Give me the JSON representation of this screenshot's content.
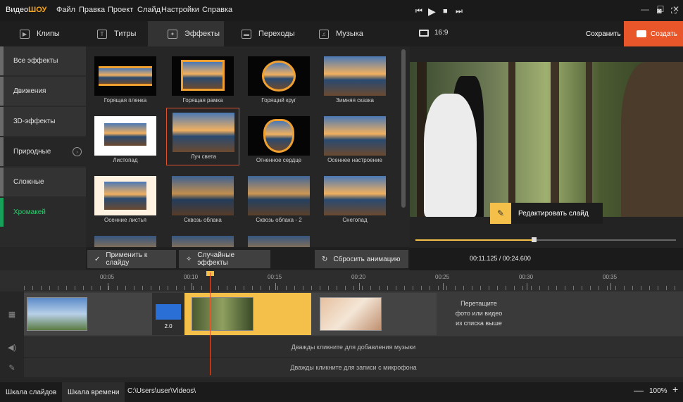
{
  "app": {
    "logo_part1": "Видео",
    "logo_part2": "ШОУ"
  },
  "menu": [
    "Файл",
    "Правка",
    "Проект",
    "Слайд",
    "Настройки",
    "Справка"
  ],
  "window_controls": {
    "minimize": "—",
    "maximize": "☐",
    "close": "✕"
  },
  "tabs": [
    {
      "label": "Клипы",
      "icon": "play-icon",
      "glyph": "▶"
    },
    {
      "label": "Титры",
      "icon": "text-icon",
      "glyph": "T"
    },
    {
      "label": "Эффекты",
      "icon": "magic-wand-icon",
      "glyph": "✦"
    },
    {
      "label": "Переходы",
      "icon": "clapper-icon",
      "glyph": "▬"
    },
    {
      "label": "Музыка",
      "icon": "music-icon",
      "glyph": "♫"
    }
  ],
  "sidebar": [
    {
      "label": "Все эффекты"
    },
    {
      "label": "Движения"
    },
    {
      "label": "3D-эффекты"
    },
    {
      "label": "Природные",
      "arrow": "›"
    },
    {
      "label": "Сложные"
    },
    {
      "label": "Хромакей"
    }
  ],
  "effects": [
    {
      "label": "Горящая пленка"
    },
    {
      "label": "Горящая рамка"
    },
    {
      "label": "Горящий круг"
    },
    {
      "label": "Зимняя сказка"
    },
    {
      "label": "Листопад"
    },
    {
      "label": "Луч света"
    },
    {
      "label": "Огненное сердце"
    },
    {
      "label": "Осеннее настроение"
    },
    {
      "label": "Осенние листья"
    },
    {
      "label": "Сквозь облака"
    },
    {
      "label": "Сквозь облака - 2"
    },
    {
      "label": "Снегопад"
    }
  ],
  "actions": {
    "apply": "Применить к слайду",
    "random": "Случайные эффекты",
    "reset": "Сбросить анимацию"
  },
  "preview": {
    "ratio": "16:9",
    "save": "Сохранить",
    "create": "Создать",
    "edit_slide": "Редактировать слайд",
    "timecode": "00:11.125 / 00:24.600",
    "progress": 0.455
  },
  "timeline": {
    "ticks": [
      "00:05",
      "00:10",
      "00:15",
      "00:20",
      "00:25",
      "00:30",
      "00:35"
    ],
    "transition_duration": "2.0",
    "drop_hint": [
      "Перетащите",
      "фото или видео",
      "из списка выше"
    ],
    "music_hint": "Дважды кликните для добавления музыки",
    "mic_hint": "Дважды кликните для записи с микрофона"
  },
  "statusbar": {
    "tab_slides": "Шкала слайдов",
    "tab_timeline": "Шкала времени",
    "path": "C:\\Users\\user\\Videos\\",
    "zoom": "100%",
    "zoom_minus": "—",
    "zoom_plus": "+"
  },
  "colors": {
    "accent": "#e8562a",
    "highlight": "#f5c04a",
    "chromakey": "#2ecc71"
  }
}
